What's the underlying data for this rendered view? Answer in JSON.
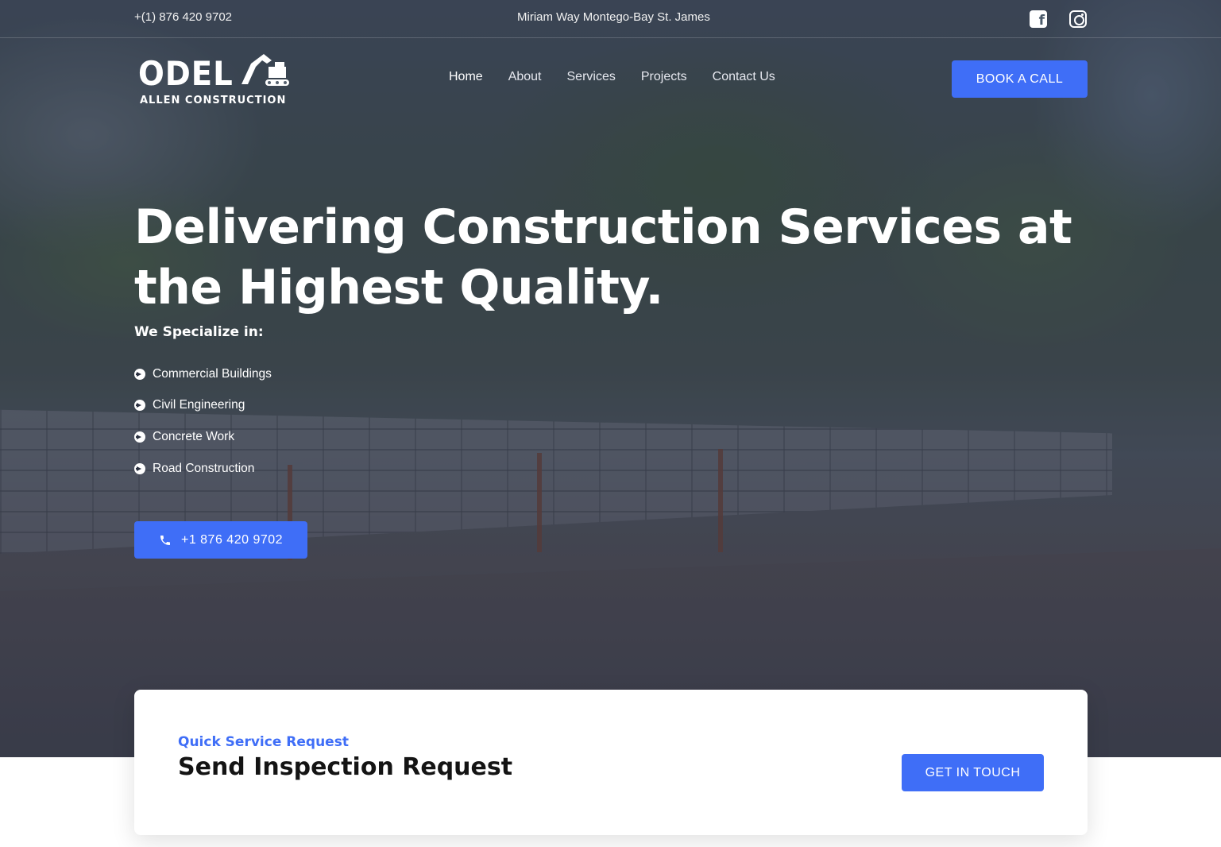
{
  "topbar": {
    "phone": "+(1) 876 420 9702",
    "address": "Miriam Way Montego-Bay St. James",
    "social": [
      "facebook-icon",
      "instagram-icon"
    ]
  },
  "logo": {
    "name": "ODEL",
    "subtitle": "ALLEN CONSTRUCTION"
  },
  "nav": {
    "items": [
      "Home",
      "About",
      "Services",
      "Projects",
      "Contact Us"
    ],
    "active": "Home"
  },
  "header_cta": "BOOK A CALL",
  "hero": {
    "headline": "Delivering Construction Services at the Highest Quality.",
    "specialize_label": "We Specialize in:",
    "specialties": [
      "Commercial Buildings",
      "Civil Engineering",
      "Concrete Work",
      "Road Construction"
    ],
    "call_button": "+1 876 420 9702"
  },
  "request_card": {
    "kicker": "Quick Service Request",
    "title": "Send Inspection Request",
    "button": "GET IN TOUCH"
  },
  "colors": {
    "accent": "#3f6ef7",
    "title_dark": "#141414"
  }
}
